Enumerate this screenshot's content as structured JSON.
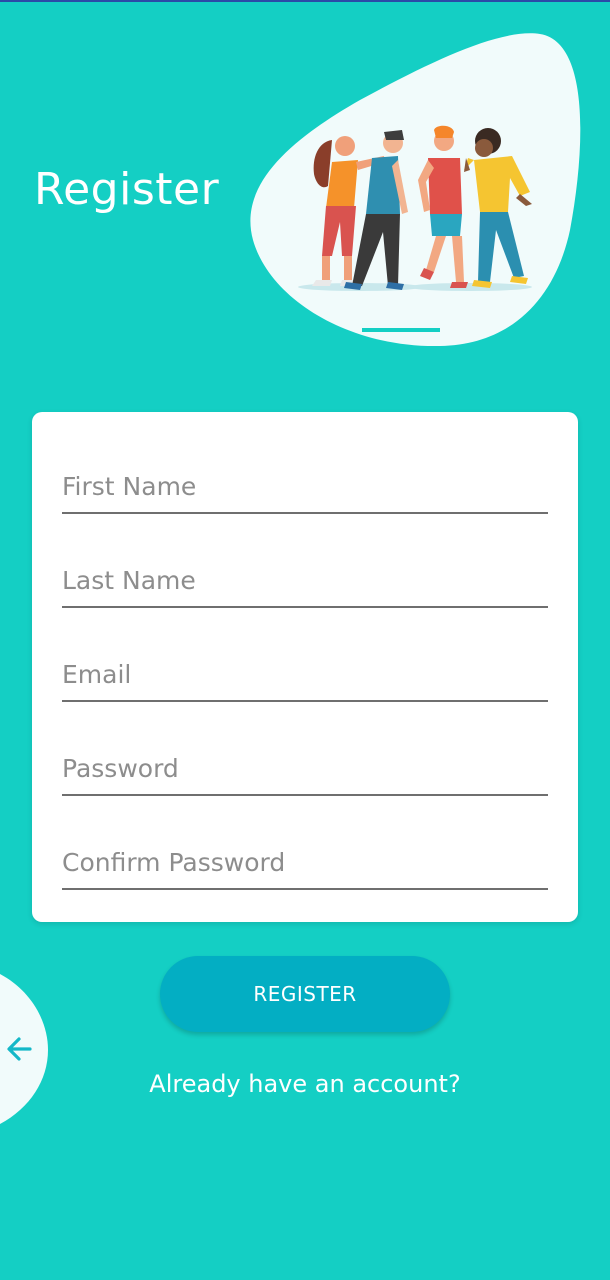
{
  "header": {
    "title": "Register"
  },
  "illustration": {
    "icon": "people-group-illustration"
  },
  "form": {
    "first_name": {
      "placeholder": "First Name",
      "value": ""
    },
    "last_name": {
      "placeholder": "Last Name",
      "value": ""
    },
    "email": {
      "placeholder": "Email",
      "value": ""
    },
    "password": {
      "placeholder": "Password",
      "value": ""
    },
    "confirm_password": {
      "placeholder": "Confirm Password",
      "value": ""
    }
  },
  "actions": {
    "register_label": "REGISTER",
    "login_link": "Already have an account?",
    "back_icon": "arrow-left-icon"
  },
  "colors": {
    "background": "#14cfc4",
    "button": "#03aec3",
    "card": "#ffffff",
    "text_on_bg": "#ffffff",
    "placeholder": "#8d8d8d"
  }
}
